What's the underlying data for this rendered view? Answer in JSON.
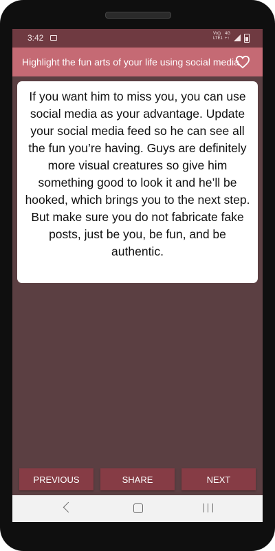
{
  "status_bar": {
    "time": "3:42",
    "network_top": "Vo))",
    "network_bottom": "LTE1",
    "network_type_top": "4G",
    "network_type_bottom": "+↑"
  },
  "app_bar": {
    "title": "Highlight the fun arts of your life using social media",
    "favorite_icon": "heart-outline-icon"
  },
  "content": {
    "text": "If you want him to miss you, you can use social media as your advantage. Update your social media feed so he can see all the fun you’re having. Guys are definitely more visual creatures so give him something good to look it and he’ll be hooked, which brings you to the next step. But make sure you do not fabricate fake posts, just be you, be fun, and be authentic."
  },
  "buttons": {
    "previous": "PREVIOUS",
    "share": "SHARE",
    "next": "NEXT"
  },
  "colors": {
    "status_bar": "#6f3a41",
    "app_bar": "#c56a74",
    "background": "#5b3f42",
    "button": "#863c45"
  }
}
